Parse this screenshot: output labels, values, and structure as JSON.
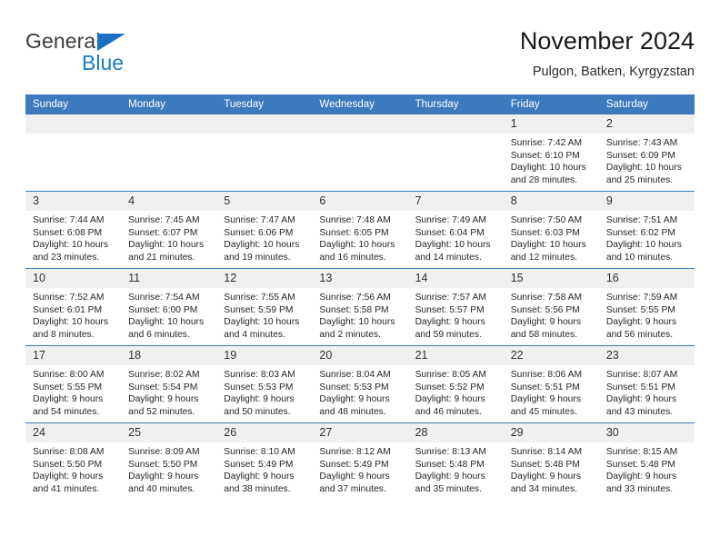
{
  "brand": {
    "name_part1": "General",
    "name_part2": "Blue",
    "mark": "triangle-logo",
    "accent_color": "#1a7cc4"
  },
  "header": {
    "title": "November 2024",
    "subtitle": "Pulgon, Batken, Kyrgyzstan"
  },
  "theme": {
    "header_row_bg": "#3a7abd",
    "daynum_bg": "#f0f0f0",
    "grid_line": "#3a7abd",
    "text": "#262626"
  },
  "calendar": {
    "weekday_headers": [
      "Sunday",
      "Monday",
      "Tuesday",
      "Wednesday",
      "Thursday",
      "Friday",
      "Saturday"
    ],
    "weeks": [
      [
        {
          "day": "",
          "lines": []
        },
        {
          "day": "",
          "lines": []
        },
        {
          "day": "",
          "lines": []
        },
        {
          "day": "",
          "lines": []
        },
        {
          "day": "",
          "lines": []
        },
        {
          "day": "1",
          "lines": [
            "Sunrise: 7:42 AM",
            "Sunset: 6:10 PM",
            "Daylight: 10 hours",
            "and 28 minutes."
          ]
        },
        {
          "day": "2",
          "lines": [
            "Sunrise: 7:43 AM",
            "Sunset: 6:09 PM",
            "Daylight: 10 hours",
            "and 25 minutes."
          ]
        }
      ],
      [
        {
          "day": "3",
          "lines": [
            "Sunrise: 7:44 AM",
            "Sunset: 6:08 PM",
            "Daylight: 10 hours",
            "and 23 minutes."
          ]
        },
        {
          "day": "4",
          "lines": [
            "Sunrise: 7:45 AM",
            "Sunset: 6:07 PM",
            "Daylight: 10 hours",
            "and 21 minutes."
          ]
        },
        {
          "day": "5",
          "lines": [
            "Sunrise: 7:47 AM",
            "Sunset: 6:06 PM",
            "Daylight: 10 hours",
            "and 19 minutes."
          ]
        },
        {
          "day": "6",
          "lines": [
            "Sunrise: 7:48 AM",
            "Sunset: 6:05 PM",
            "Daylight: 10 hours",
            "and 16 minutes."
          ]
        },
        {
          "day": "7",
          "lines": [
            "Sunrise: 7:49 AM",
            "Sunset: 6:04 PM",
            "Daylight: 10 hours",
            "and 14 minutes."
          ]
        },
        {
          "day": "8",
          "lines": [
            "Sunrise: 7:50 AM",
            "Sunset: 6:03 PM",
            "Daylight: 10 hours",
            "and 12 minutes."
          ]
        },
        {
          "day": "9",
          "lines": [
            "Sunrise: 7:51 AM",
            "Sunset: 6:02 PM",
            "Daylight: 10 hours",
            "and 10 minutes."
          ]
        }
      ],
      [
        {
          "day": "10",
          "lines": [
            "Sunrise: 7:52 AM",
            "Sunset: 6:01 PM",
            "Daylight: 10 hours",
            "and 8 minutes."
          ]
        },
        {
          "day": "11",
          "lines": [
            "Sunrise: 7:54 AM",
            "Sunset: 6:00 PM",
            "Daylight: 10 hours",
            "and 6 minutes."
          ]
        },
        {
          "day": "12",
          "lines": [
            "Sunrise: 7:55 AM",
            "Sunset: 5:59 PM",
            "Daylight: 10 hours",
            "and 4 minutes."
          ]
        },
        {
          "day": "13",
          "lines": [
            "Sunrise: 7:56 AM",
            "Sunset: 5:58 PM",
            "Daylight: 10 hours",
            "and 2 minutes."
          ]
        },
        {
          "day": "14",
          "lines": [
            "Sunrise: 7:57 AM",
            "Sunset: 5:57 PM",
            "Daylight: 9 hours",
            "and 59 minutes."
          ]
        },
        {
          "day": "15",
          "lines": [
            "Sunrise: 7:58 AM",
            "Sunset: 5:56 PM",
            "Daylight: 9 hours",
            "and 58 minutes."
          ]
        },
        {
          "day": "16",
          "lines": [
            "Sunrise: 7:59 AM",
            "Sunset: 5:55 PM",
            "Daylight: 9 hours",
            "and 56 minutes."
          ]
        }
      ],
      [
        {
          "day": "17",
          "lines": [
            "Sunrise: 8:00 AM",
            "Sunset: 5:55 PM",
            "Daylight: 9 hours",
            "and 54 minutes."
          ]
        },
        {
          "day": "18",
          "lines": [
            "Sunrise: 8:02 AM",
            "Sunset: 5:54 PM",
            "Daylight: 9 hours",
            "and 52 minutes."
          ]
        },
        {
          "day": "19",
          "lines": [
            "Sunrise: 8:03 AM",
            "Sunset: 5:53 PM",
            "Daylight: 9 hours",
            "and 50 minutes."
          ]
        },
        {
          "day": "20",
          "lines": [
            "Sunrise: 8:04 AM",
            "Sunset: 5:53 PM",
            "Daylight: 9 hours",
            "and 48 minutes."
          ]
        },
        {
          "day": "21",
          "lines": [
            "Sunrise: 8:05 AM",
            "Sunset: 5:52 PM",
            "Daylight: 9 hours",
            "and 46 minutes."
          ]
        },
        {
          "day": "22",
          "lines": [
            "Sunrise: 8:06 AM",
            "Sunset: 5:51 PM",
            "Daylight: 9 hours",
            "and 45 minutes."
          ]
        },
        {
          "day": "23",
          "lines": [
            "Sunrise: 8:07 AM",
            "Sunset: 5:51 PM",
            "Daylight: 9 hours",
            "and 43 minutes."
          ]
        }
      ],
      [
        {
          "day": "24",
          "lines": [
            "Sunrise: 8:08 AM",
            "Sunset: 5:50 PM",
            "Daylight: 9 hours",
            "and 41 minutes."
          ]
        },
        {
          "day": "25",
          "lines": [
            "Sunrise: 8:09 AM",
            "Sunset: 5:50 PM",
            "Daylight: 9 hours",
            "and 40 minutes."
          ]
        },
        {
          "day": "26",
          "lines": [
            "Sunrise: 8:10 AM",
            "Sunset: 5:49 PM",
            "Daylight: 9 hours",
            "and 38 minutes."
          ]
        },
        {
          "day": "27",
          "lines": [
            "Sunrise: 8:12 AM",
            "Sunset: 5:49 PM",
            "Daylight: 9 hours",
            "and 37 minutes."
          ]
        },
        {
          "day": "28",
          "lines": [
            "Sunrise: 8:13 AM",
            "Sunset: 5:48 PM",
            "Daylight: 9 hours",
            "and 35 minutes."
          ]
        },
        {
          "day": "29",
          "lines": [
            "Sunrise: 8:14 AM",
            "Sunset: 5:48 PM",
            "Daylight: 9 hours",
            "and 34 minutes."
          ]
        },
        {
          "day": "30",
          "lines": [
            "Sunrise: 8:15 AM",
            "Sunset: 5:48 PM",
            "Daylight: 9 hours",
            "and 33 minutes."
          ]
        }
      ]
    ]
  }
}
